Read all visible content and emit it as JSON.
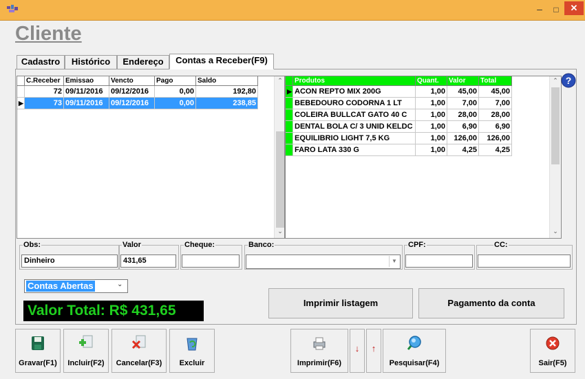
{
  "window": {
    "close_glyph": "✕",
    "min_glyph": "–",
    "max_glyph": "□",
    "app_icon": "app-icon"
  },
  "page_title": "Cliente",
  "tabs": [
    {
      "label": "Cadastro"
    },
    {
      "label": "Histórico"
    },
    {
      "label": "Endereço"
    },
    {
      "label": "Contas a Receber(F9)",
      "active": true
    }
  ],
  "receivables": {
    "columns": [
      "C.Receber",
      "Emissao",
      "Vencto",
      "Pago",
      "Saldo"
    ],
    "rows": [
      {
        "c_receber": "72",
        "emissao": "09/11/2016",
        "vencto": "09/12/2016",
        "pago": "0,00",
        "saldo": "192,80",
        "selected": false
      },
      {
        "c_receber": "73",
        "emissao": "09/11/2016",
        "vencto": "09/12/2016",
        "pago": "0,00",
        "saldo": "238,85",
        "selected": true
      }
    ]
  },
  "products": {
    "columns": [
      "Produtos",
      "Quant.",
      "Valor",
      "Total"
    ],
    "header_color": "#00ee00",
    "rows": [
      {
        "produto": "ACON REPTO MIX 200G",
        "quant": "1,00",
        "valor": "45,00",
        "total": "45,00"
      },
      {
        "produto": "BEBEDOURO CODORNA 1 LT",
        "quant": "1,00",
        "valor": "7,00",
        "total": "7,00"
      },
      {
        "produto": "COLEIRA  BULLCAT GATO 40 C",
        "quant": "1,00",
        "valor": "28,00",
        "total": "28,00"
      },
      {
        "produto": "DENTAL BOLA C/ 3 UNID KELDC",
        "quant": "1,00",
        "valor": "6,90",
        "total": "6,90"
      },
      {
        "produto": "EQUILIBRIO LIGHT 7,5 KG",
        "quant": "1,00",
        "valor": "126,00",
        "total": "126,00"
      },
      {
        "produto": "FARO LATA 330 G",
        "quant": "1,00",
        "valor": "4,25",
        "total": "4,25"
      }
    ]
  },
  "fields": {
    "obs_label": "Obs:",
    "obs_value": "Dinheiro",
    "valor_label": "Valor",
    "valor_value": "431,65",
    "cheque_label": "Cheque:",
    "cheque_value": "",
    "banco_label": "Banco:",
    "banco_value": "",
    "cpf_label": "CPF:",
    "cpf_value": "",
    "cc_label": "CC:",
    "cc_value": ""
  },
  "status_filter": {
    "selected": "Contas Abertas"
  },
  "total_display": "Valor Total: R$ 431,65",
  "buttons": {
    "print_list": "Imprimir listagem",
    "pay_account": "Pagamento da conta"
  },
  "toolbar": [
    {
      "label": "Gravar(F1)",
      "icon": "save-icon"
    },
    {
      "label": "Incluir(F2)",
      "icon": "add-icon"
    },
    {
      "label": "Cancelar(F3)",
      "icon": "cancel-icon"
    },
    {
      "label": "Excluir",
      "icon": "recycle-icon"
    },
    {
      "label": "Imprimir(F6)",
      "icon": "printer-icon"
    },
    {
      "label": "",
      "icon": "arrow-down-icon"
    },
    {
      "label": "",
      "icon": "arrow-up-icon"
    },
    {
      "label": "Pesquisar(F4)",
      "icon": "search-icon"
    },
    {
      "label": "Sair(F5)",
      "icon": "exit-icon"
    }
  ],
  "help_icon": "help-icon"
}
